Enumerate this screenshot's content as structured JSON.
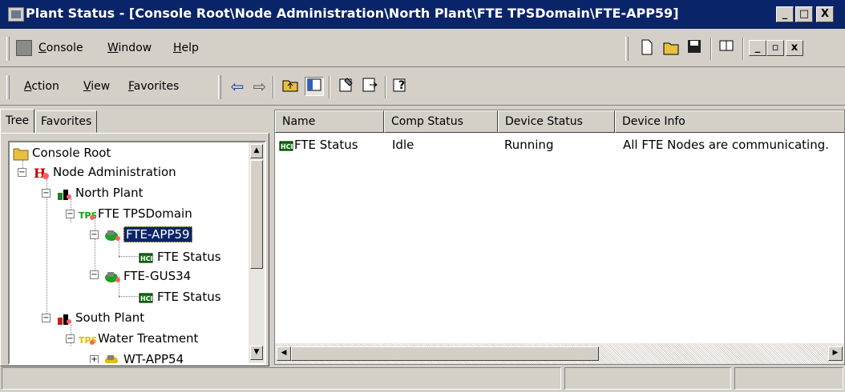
{
  "window": {
    "title": "Plant Status - [Console Root\\Node Administration\\North Plant\\FTE TPSDomain\\FTE-APP59]",
    "caption_buttons": {
      "minimize": "_",
      "maximize": "□",
      "close": "X"
    }
  },
  "menubar": {
    "items": [
      {
        "label": "Console",
        "accel": "C"
      },
      {
        "label": "Window",
        "accel": "W"
      },
      {
        "label": "Help",
        "accel": "H"
      }
    ],
    "right_icons": [
      "new-icon",
      "open-icon",
      "save-icon",
      "properties-icon"
    ],
    "mdi_buttons": {
      "minimize": "_",
      "restore": "▫",
      "close": "x"
    }
  },
  "toolbar": {
    "items": [
      {
        "label": "Action",
        "accel": "A"
      },
      {
        "label": "View",
        "accel": "V"
      },
      {
        "label": "Favorites",
        "accel": "F"
      }
    ],
    "icons": [
      "back-icon",
      "forward-icon",
      "up-one-level-icon",
      "show-hide-tree-icon",
      "properties-icon",
      "export-list-icon",
      "help-icon"
    ]
  },
  "tabs": [
    {
      "label": "Tree",
      "active": true
    },
    {
      "label": "Favorites",
      "active": false
    }
  ],
  "tree": [
    {
      "label": "Console Root",
      "icon": "folder-icon",
      "level": 0
    },
    {
      "label": "Node Administration",
      "icon": "node-admin-icon",
      "level": 0
    },
    {
      "label": "North Plant",
      "icon": "plant-icon",
      "level": 1
    },
    {
      "label": "FTE TPSDomain",
      "icon": "tps-domain-icon",
      "level": 2
    },
    {
      "label": "FTE-APP59",
      "icon": "node-icon",
      "level": 3,
      "selected": true
    },
    {
      "label": "FTE Status",
      "icon": "fte-status-icon",
      "level": 4
    },
    {
      "label": "FTE-GUS34",
      "icon": "node-icon",
      "level": 3
    },
    {
      "label": "FTE Status",
      "icon": "fte-status-icon",
      "level": 4
    },
    {
      "label": "South Plant",
      "icon": "plant-icon",
      "level": 1
    },
    {
      "label": "Water Treatment",
      "icon": "tps-domain-icon",
      "level": 2
    },
    {
      "label": "WT-APP54",
      "icon": "node-icon",
      "level": 3
    }
  ],
  "list": {
    "columns": [
      "Name",
      "Comp Status",
      "Device Status",
      "Device Info"
    ],
    "rows": [
      {
        "name": "FTE Status",
        "comp_status": "Idle",
        "device_status": "Running",
        "device_info": "All FTE Nodes are communicating."
      }
    ]
  },
  "colors": {
    "titlebar": "#0a246a",
    "selection": "#0a246a",
    "face": "#d4d0c8"
  }
}
